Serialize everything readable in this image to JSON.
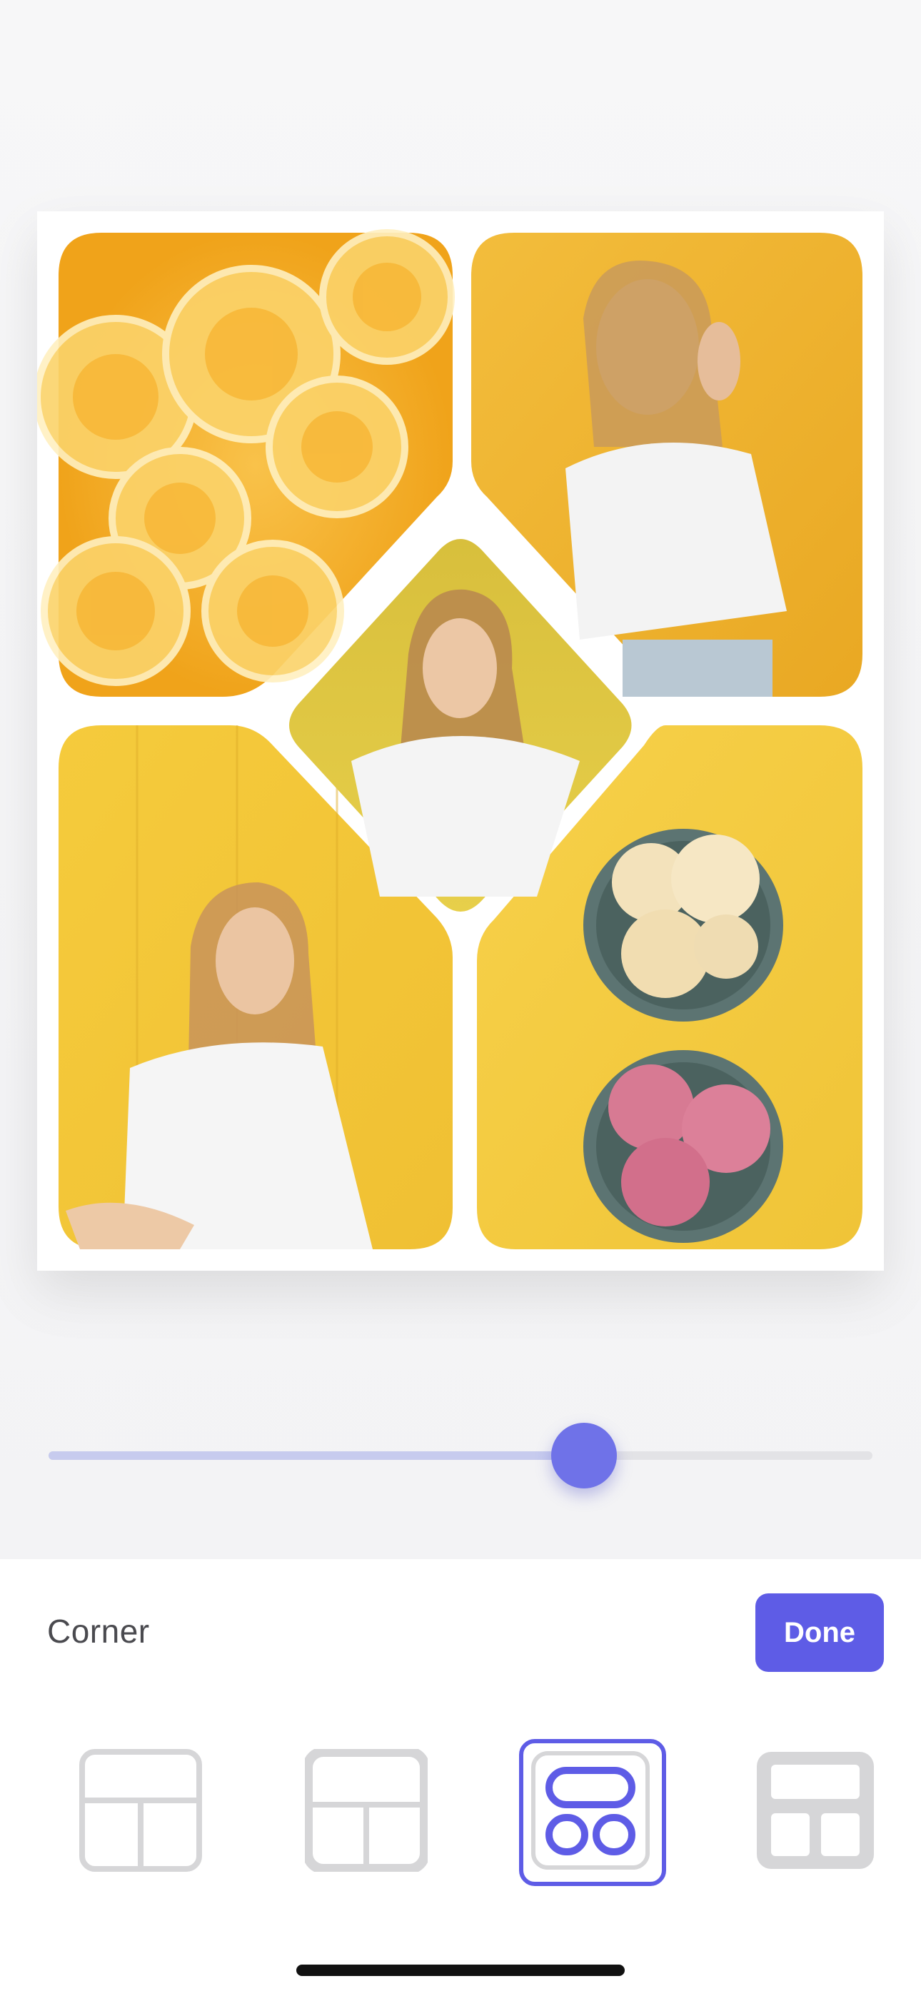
{
  "slider": {
    "value": 0.65
  },
  "panel": {
    "title": "Corner",
    "done_label": "Done"
  },
  "layouts": [
    {
      "name": "layout-option-1",
      "selected": false
    },
    {
      "name": "layout-option-2",
      "selected": false
    },
    {
      "name": "layout-option-3",
      "selected": true
    },
    {
      "name": "layout-option-4",
      "selected": false
    }
  ],
  "colors": {
    "accent": "#5e5ce6",
    "slider_thumb": "#6f72e8",
    "slider_fill": "#c7cbee",
    "slider_track": "#e3e3e6",
    "icon_gray": "#d6d6d8"
  },
  "collage": {
    "photos": [
      {
        "name": "photo-orange-slices"
      },
      {
        "name": "photo-girl-hand-on-face"
      },
      {
        "name": "photo-girl-center-diamond"
      },
      {
        "name": "photo-girl-sitting"
      },
      {
        "name": "photo-ice-cream-bowls"
      }
    ]
  }
}
